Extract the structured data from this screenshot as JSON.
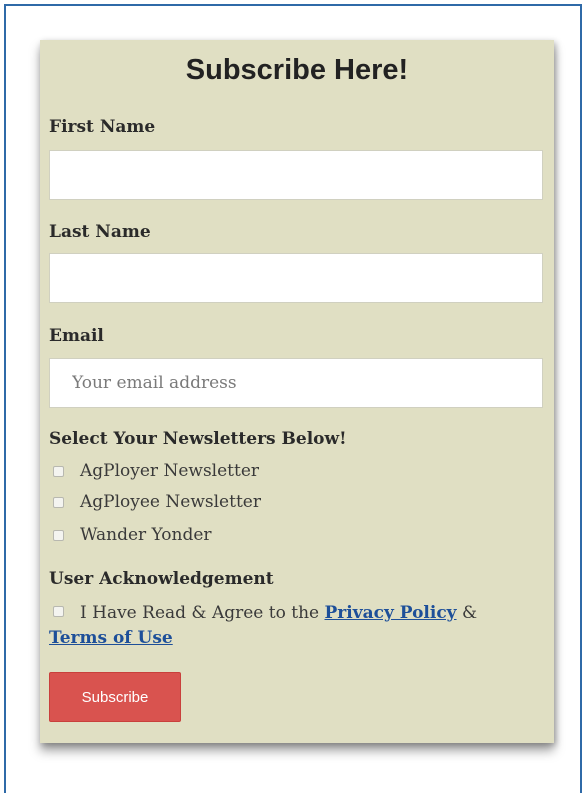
{
  "form": {
    "title": "Subscribe Here!",
    "first_name": {
      "label": "First Name",
      "value": "",
      "placeholder": ""
    },
    "last_name": {
      "label": "Last Name",
      "value": "",
      "placeholder": ""
    },
    "email": {
      "label": "Email",
      "value": "",
      "placeholder": "Your email address"
    },
    "newsletters": {
      "heading": "Select Your Newsletters Below!",
      "options": [
        {
          "label": "AgPloyer Newsletter",
          "checked": false
        },
        {
          "label": "AgPloyee Newsletter",
          "checked": false
        },
        {
          "label": "Wander Yonder",
          "checked": false
        }
      ]
    },
    "acknowledgement": {
      "heading": "User Acknowledgement",
      "text_before": "I Have Read & Agree to the",
      "privacy_link": "Privacy Policy",
      "ampersand": "&",
      "terms_link": "Terms of Use",
      "checked": false
    },
    "submit_label": "Subscribe"
  },
  "colors": {
    "card_background": "#e0dfc3",
    "button": "#d9534f",
    "link": "#1d4f99",
    "frame_border": "#2f6aa8"
  }
}
